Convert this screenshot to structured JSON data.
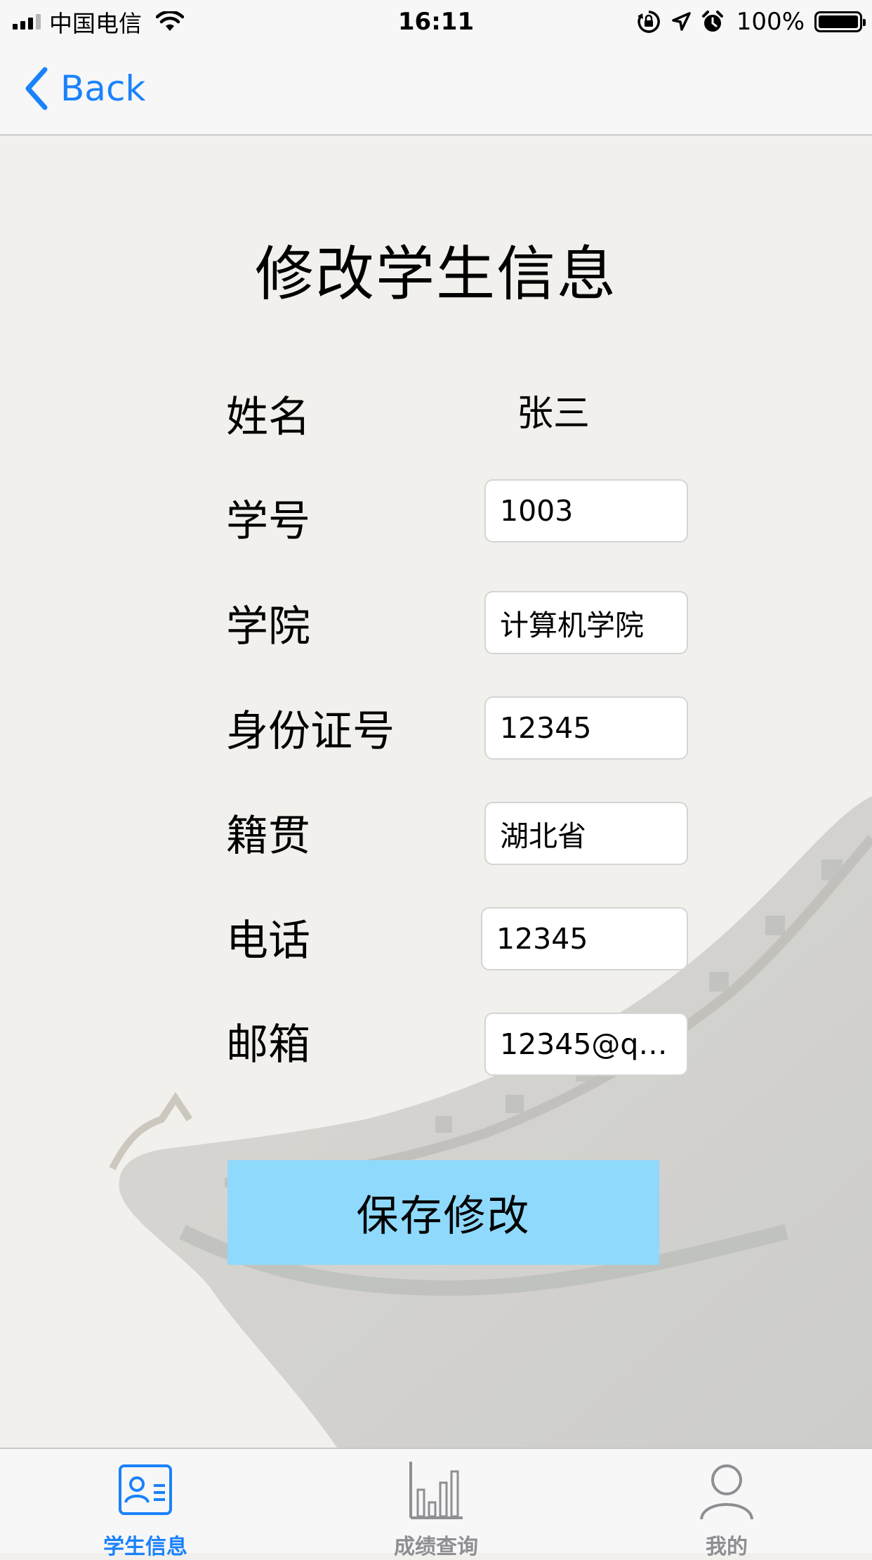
{
  "status_bar": {
    "carrier": "中国电信",
    "time": "16:11",
    "battery_percent": "100%",
    "battery_level": 1.0,
    "icons": [
      "signal-icon",
      "wifi-icon",
      "orientation-lock-icon",
      "location-icon",
      "alarm-icon",
      "battery-icon"
    ]
  },
  "nav": {
    "back_label": "Back"
  },
  "form": {
    "title": "修改学生信息",
    "name_label": "姓名",
    "name_value": "张三",
    "fields": [
      {
        "label": "学号",
        "value": "1003"
      },
      {
        "label": "学院",
        "value": "计算机学院"
      },
      {
        "label": "身份证号",
        "value": "12345"
      },
      {
        "label": "籍贯",
        "value": "湖北省"
      },
      {
        "label": "电话",
        "value": "12345"
      },
      {
        "label": "邮箱",
        "value": "12345@qq..."
      }
    ],
    "save_label": "保存修改"
  },
  "tabbar": {
    "tabs": [
      {
        "label": "学生信息",
        "icon": "student-card-icon",
        "active": true
      },
      {
        "label": "成绩查询",
        "icon": "bar-chart-icon",
        "active": false
      },
      {
        "label": "我的",
        "icon": "person-icon",
        "active": false
      }
    ]
  },
  "colors": {
    "accent": "#1a82fb",
    "save_button": "#8fd9fc",
    "background": "#f1f0ec",
    "inactive_tab": "#8e8e93"
  }
}
